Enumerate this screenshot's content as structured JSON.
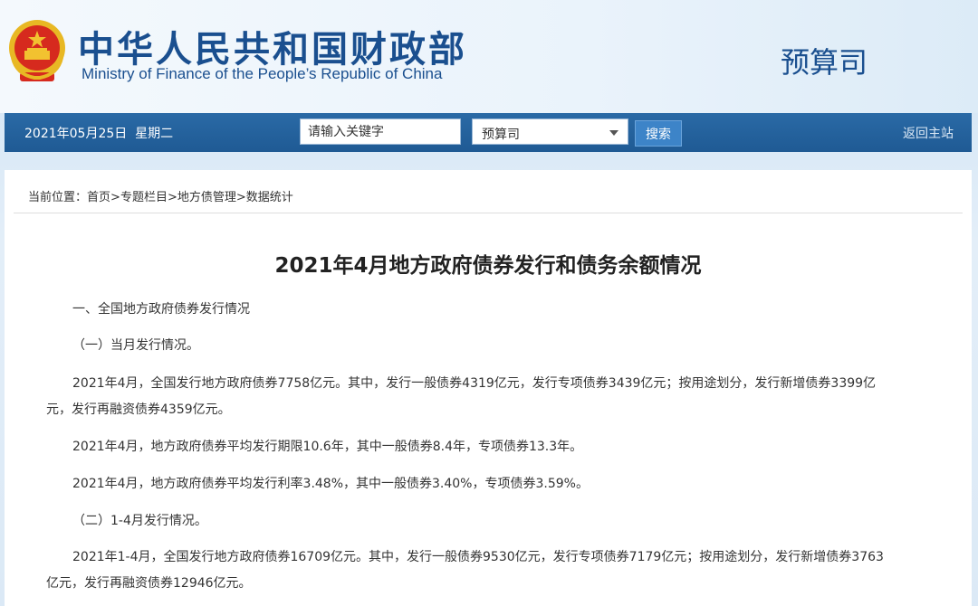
{
  "header": {
    "title_zh": "中华人民共和国财政部",
    "title_en": "Ministry of Finance of the People’s Republic of China",
    "department": "预算司",
    "emblem_icon": "national-emblem-icon"
  },
  "navbar": {
    "date": "2021年05月25日",
    "weekday": "星期二",
    "search_placeholder": "请输入关键字",
    "scope_selected": "预算司",
    "search_label": "搜索",
    "home_label": "返回主站"
  },
  "breadcrumb": {
    "prefix": "当前位置：",
    "items": [
      "首页",
      "专题栏目",
      "地方债管理",
      "数据统计"
    ],
    "separator": ">"
  },
  "article": {
    "title": "2021年4月地方政府债券发行和债务余额情况",
    "paragraphs": [
      "一、全国地方政府债券发行情况",
      "（一）当月发行情况。",
      "2021年4月，全国发行地方政府债券7758亿元。其中，发行一般债券4319亿元，发行专项债券3439亿元；按用途划分，发行新增债券3399亿",
      "元，发行再融资债券4359亿元。",
      "2021年4月，地方政府债券平均发行期限10.6年，其中一般债券8.4年，专项债券13.3年。",
      "2021年4月，地方政府债券平均发行利率3.48%，其中一般债券3.40%，专项债券3.59%。",
      "（二）1-4月发行情况。",
      "2021年1-4月，全国发行地方政府债券16709亿元。其中，发行一般债券9530亿元，发行专项债券7179亿元；按用途划分，发行新增债券3763",
      "亿元，发行再融资债券12946亿元。"
    ]
  },
  "colors": {
    "brand_blue": "#1a4f8f",
    "nav_bg": "#1f5a94",
    "search_btn": "#3d84c8",
    "emblem_red": "#d62a1e",
    "emblem_gold": "#f2c230"
  }
}
